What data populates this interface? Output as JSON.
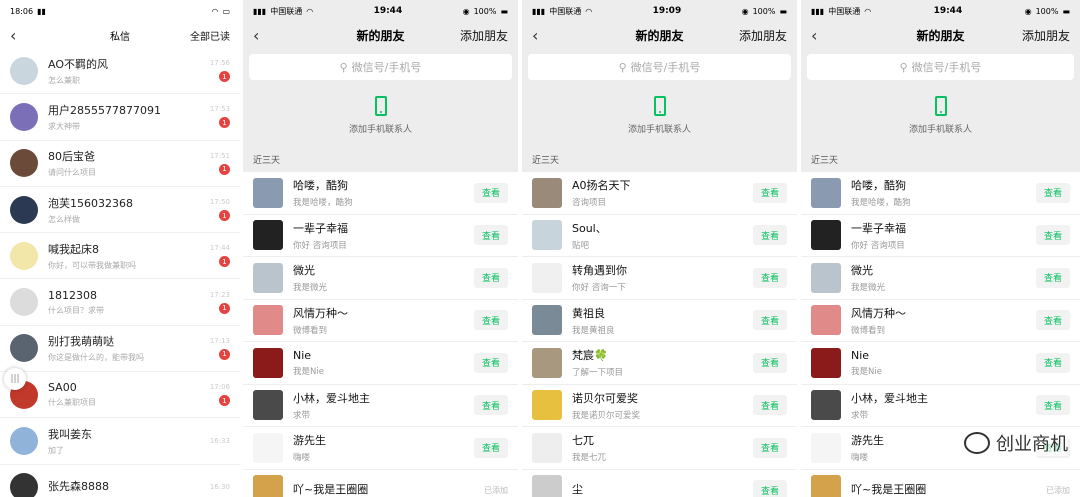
{
  "panel0": {
    "status": {
      "time": "18:06",
      "net": "0.00\nK/S"
    },
    "nav": {
      "back": "‹",
      "title": "私信",
      "action": "全部已读"
    },
    "messages": [
      {
        "name": "AO不羁的风",
        "preview": "怎么兼职",
        "time": "17:56",
        "badge": "1",
        "color": "#c9d6de"
      },
      {
        "name": "用户2855577877091",
        "preview": "求大神带",
        "time": "17:53",
        "badge": "1",
        "color": "#7b6fb8"
      },
      {
        "name": "80后宝爸",
        "preview": "请问什么项目",
        "time": "17:51",
        "badge": "1",
        "color": "#6b4a3a"
      },
      {
        "name": "泡芙156032368",
        "preview": "怎么样做",
        "time": "17:50",
        "badge": "1",
        "color": "#2b3a52"
      },
      {
        "name": "喊我起床8",
        "preview": "你好，可以带我做兼职吗",
        "time": "17:44",
        "badge": "1",
        "color": "#f2e6a8"
      },
      {
        "name": "1812308",
        "preview": "什么项目？求带",
        "time": "17:23",
        "badge": "1",
        "color": "#dcdcdc"
      },
      {
        "name": "别打我萌萌哒",
        "preview": "你这是做什么的，能带我吗",
        "time": "17:13",
        "badge": "1",
        "color": "#5a6470"
      },
      {
        "name": "SA00",
        "preview": "什么兼职项目",
        "time": "17:06",
        "badge": "1",
        "color": "#c0392b"
      },
      {
        "name": "我叫姜东",
        "preview": "加了",
        "time": "16:33",
        "badge": "",
        "color": "#8fb3d9"
      },
      {
        "name": "张先森8888",
        "preview": "",
        "time": "16:30",
        "badge": "",
        "color": "#333"
      }
    ],
    "voice_icon": "voice-icon"
  },
  "panel1": {
    "status": {
      "carrier": "中国联通",
      "time": "19:44",
      "battery": "100%"
    },
    "nav": {
      "back": "‹",
      "title": "新的朋友",
      "action": "添加朋友"
    },
    "search_placeholder": "微信号/手机号",
    "phone_label": "添加手机联系人",
    "section": "近三天",
    "friends": [
      {
        "name": "哈喽，酷狗",
        "sub": "我是哈喽，酷狗",
        "btn": "查看",
        "color": "#8a9ab0"
      },
      {
        "name": "一辈子幸福",
        "sub": "你好 咨询项目",
        "btn": "查看",
        "color": "#222"
      },
      {
        "name": "微光",
        "sub": "我是微光",
        "btn": "查看",
        "color": "#b9c4cc"
      },
      {
        "name": "风情万种～",
        "sub": "微博看到",
        "btn": "查看",
        "color": "#e08a8a"
      },
      {
        "name": "Nie",
        "sub": "我是Nie",
        "btn": "查看",
        "color": "#8b1a1a"
      },
      {
        "name": "小林，爱斗地主",
        "sub": "求带",
        "btn": "查看",
        "color": "#4a4a4a"
      },
      {
        "name": "游先生",
        "sub": "嗨喽",
        "btn": "查看",
        "color": "#f5f5f5"
      },
      {
        "name": "吖~我是王圈圈",
        "sub": "",
        "btn": "已添加",
        "color": "#d4a24a"
      }
    ]
  },
  "panel2": {
    "status": {
      "carrier": "中国联通",
      "time": "19:09",
      "battery": "100%"
    },
    "nav": {
      "back": "‹",
      "title": "新的朋友",
      "action": "添加朋友"
    },
    "search_placeholder": "微信号/手机号",
    "phone_label": "添加手机联系人",
    "section": "近三天",
    "friends": [
      {
        "name": "A0扬名天下",
        "sub": "咨询项目",
        "btn": "查看",
        "color": "#9a8a7a"
      },
      {
        "name": "Soul、",
        "sub": "贴吧",
        "btn": "查看",
        "color": "#c8d4dc"
      },
      {
        "name": "转角遇到你",
        "sub": "你好 咨询一下",
        "btn": "查看",
        "color": "#f0f0f0"
      },
      {
        "name": "黄祖良",
        "sub": "我是黄祖良",
        "btn": "查看",
        "color": "#7a8a96"
      },
      {
        "name": "梵宸🍀",
        "sub": "了解一下项目",
        "btn": "查看",
        "color": "#a89880"
      },
      {
        "name": "诺贝尔可爱奖",
        "sub": "我是诺贝尔可爱奖",
        "btn": "查看",
        "color": "#e8c040"
      },
      {
        "name": "七兀",
        "sub": "我是七兀",
        "btn": "查看",
        "color": "#eeeeee"
      },
      {
        "name": "尘",
        "sub": "",
        "btn": "查看",
        "color": "#cccccc"
      }
    ]
  },
  "panel3": {
    "status": {
      "carrier": "中国联通",
      "time": "19:44",
      "battery": "100%"
    },
    "nav": {
      "back": "‹",
      "title": "新的朋友",
      "action": "添加朋友"
    },
    "search_placeholder": "微信号/手机号",
    "phone_label": "添加手机联系人",
    "section": "近三天",
    "friends": [
      {
        "name": "哈喽，酷狗",
        "sub": "我是哈喽，酷狗",
        "btn": "查看",
        "color": "#8a9ab0"
      },
      {
        "name": "一辈子幸福",
        "sub": "你好 咨询项目",
        "btn": "查看",
        "color": "#222"
      },
      {
        "name": "微光",
        "sub": "我是微光",
        "btn": "查看",
        "color": "#b9c4cc"
      },
      {
        "name": "风情万种～",
        "sub": "微博看到",
        "btn": "查看",
        "color": "#e08a8a"
      },
      {
        "name": "Nie",
        "sub": "我是Nie",
        "btn": "查看",
        "color": "#8b1a1a"
      },
      {
        "name": "小林，爱斗地主",
        "sub": "求带",
        "btn": "查看",
        "color": "#4a4a4a"
      },
      {
        "name": "游先生",
        "sub": "嗨喽",
        "btn": "查看",
        "color": "#f5f5f5"
      },
      {
        "name": "吖~我是王圈圈",
        "sub": "",
        "btn": "已添加",
        "color": "#d4a24a"
      }
    ],
    "watermark": "创业商机"
  },
  "colors": {
    "accent": "#07c160",
    "badge": "#e64340",
    "bg": "#ededed"
  }
}
